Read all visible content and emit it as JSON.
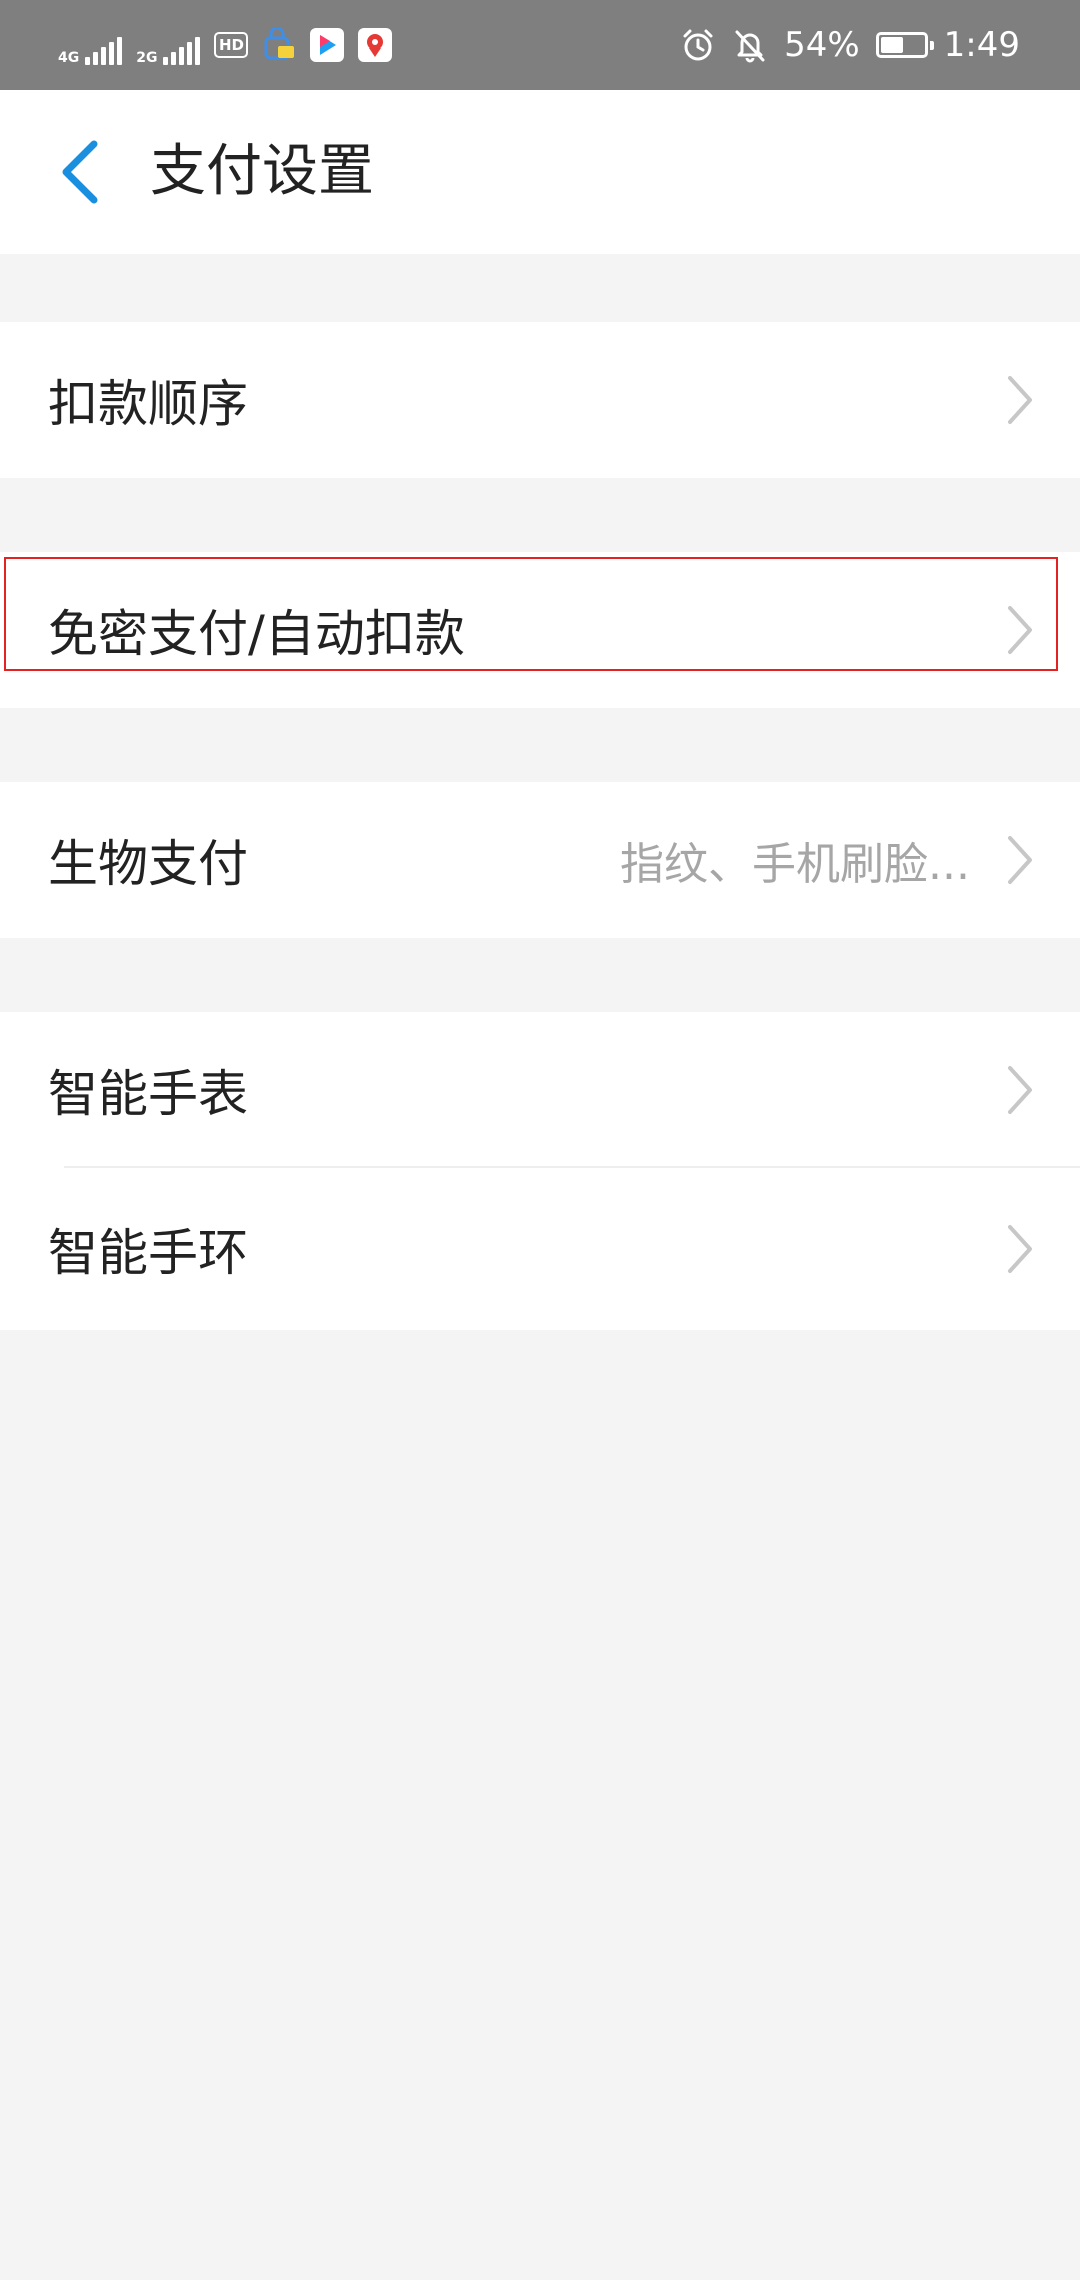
{
  "status_bar": {
    "signal1_tag": "4G",
    "signal2_tag": "2G",
    "hd_label": "HD",
    "battery_percent": "54%",
    "battery_level": 0.54,
    "time": "1:49"
  },
  "header": {
    "title": "支付设置"
  },
  "settings": {
    "deduction_order": "扣款顺序",
    "password_free": "免密支付/自动扣款",
    "biometric": "生物支付",
    "biometric_value": "指纹、手机刷脸...",
    "smart_watch": "智能手表",
    "smart_band": "智能手环"
  },
  "colors": {
    "accent": "#1a8fe0",
    "highlight": "#e32222",
    "status_bar": "#7f7f7f"
  }
}
